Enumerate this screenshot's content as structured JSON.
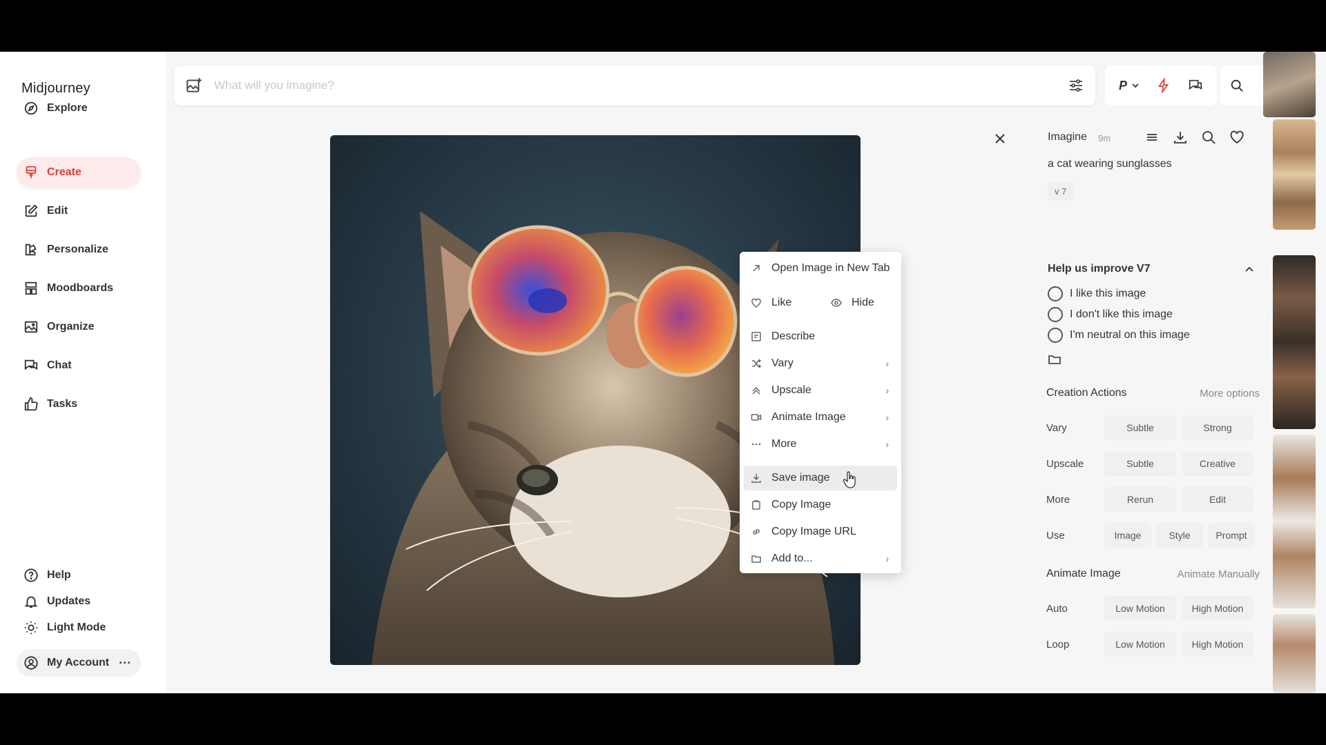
{
  "app": {
    "name": "Midjourney"
  },
  "sidebar": {
    "items": [
      {
        "label": "Explore",
        "icon": "compass-icon"
      },
      {
        "label": "Create",
        "icon": "brush-icon",
        "active": true
      },
      {
        "label": "Edit",
        "icon": "pencil-square-icon"
      },
      {
        "label": "Personalize",
        "icon": "palette-icon"
      },
      {
        "label": "Moodboards",
        "icon": "grid-icon"
      },
      {
        "label": "Organize",
        "icon": "image-icon"
      },
      {
        "label": "Chat",
        "icon": "chat-icon"
      },
      {
        "label": "Tasks",
        "icon": "thumbs-up-icon"
      }
    ],
    "bottom": [
      {
        "label": "Help",
        "icon": "help-icon"
      },
      {
        "label": "Updates",
        "icon": "bell-icon"
      },
      {
        "label": "Light Mode",
        "icon": "sun-icon"
      }
    ],
    "account": {
      "label": "My Account",
      "more": "···"
    }
  },
  "prompt": {
    "placeholder": "What will you imagine?",
    "value": ""
  },
  "toolbar": {
    "personalize_label": "P"
  },
  "context_menu": {
    "items": [
      {
        "label": "Open Image in New Tab",
        "icon": "external-link-icon"
      },
      {
        "label": "Like",
        "icon": "heart-icon",
        "pair": {
          "label": "Hide",
          "icon": "eye-icon"
        }
      },
      {
        "label": "Describe",
        "icon": "describe-icon"
      },
      {
        "label": "Vary",
        "icon": "shuffle-icon",
        "submenu": true
      },
      {
        "label": "Upscale",
        "icon": "upscale-icon",
        "submenu": true
      },
      {
        "label": "Animate Image",
        "icon": "video-icon",
        "submenu": true
      },
      {
        "label": "More",
        "icon": "ellipsis-icon",
        "submenu": true
      },
      {
        "label": "Save image",
        "icon": "download-icon",
        "hovered": true
      },
      {
        "label": "Copy Image",
        "icon": "clipboard-icon"
      },
      {
        "label": "Copy Image URL",
        "icon": "link-icon"
      },
      {
        "label": "Add to...",
        "icon": "folder-icon",
        "submenu": true
      }
    ]
  },
  "details": {
    "title": "Imagine",
    "time": "9m",
    "prompt_text": "a cat wearing sunglasses",
    "version": "v 7",
    "feedback": {
      "title": "Help us improve V7",
      "options": [
        "I like this image",
        "I don't like this image",
        "I'm neutral on this image"
      ]
    },
    "creation_actions": {
      "title": "Creation Actions",
      "link": "More options",
      "rows": [
        {
          "label": "Vary",
          "buttons": [
            "Subtle",
            "Strong"
          ]
        },
        {
          "label": "Upscale",
          "buttons": [
            "Subtle",
            "Creative"
          ]
        },
        {
          "label": "More",
          "buttons": [
            "Rerun",
            "Edit"
          ]
        },
        {
          "label": "Use",
          "buttons": [
            "Image",
            "Style",
            "Prompt"
          ]
        }
      ]
    },
    "animate": {
      "title": "Animate Image",
      "link": "Animate Manually",
      "rows": [
        {
          "label": "Auto",
          "buttons": [
            "Low Motion",
            "High Motion"
          ]
        },
        {
          "label": "Loop",
          "buttons": [
            "Low Motion",
            "High Motion"
          ]
        }
      ]
    }
  },
  "colors": {
    "accent": "#d9413b",
    "active_bg": "#fdeaea",
    "lightning": "#e0483f"
  }
}
